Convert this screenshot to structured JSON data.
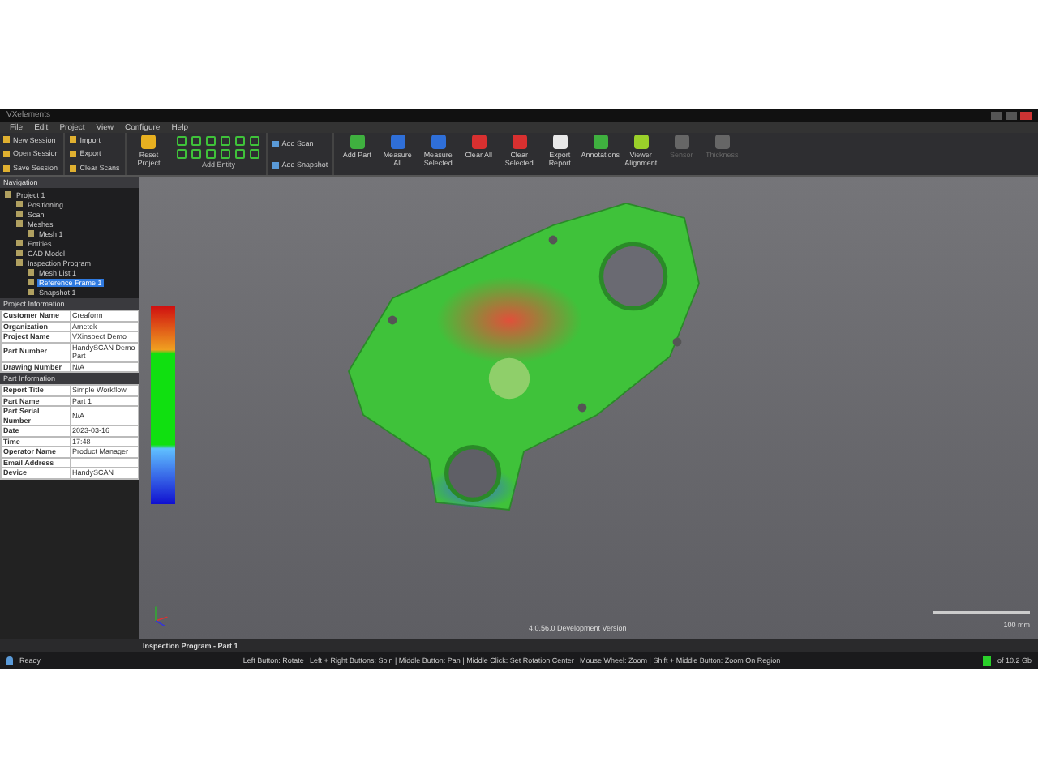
{
  "window": {
    "title": "VXelements"
  },
  "menu": [
    "File",
    "Edit",
    "Project",
    "View",
    "Configure",
    "Help"
  ],
  "ribbon": {
    "small_groups": [
      [
        "New Session",
        "Open Session",
        "Save Session"
      ],
      [
        "Import",
        "Export",
        "Clear Scans"
      ]
    ],
    "reset": "Reset Project",
    "entity_group": "Add Entity",
    "scan_group": [
      "Add Scan",
      "Add Snapshot"
    ],
    "buttons": [
      {
        "label": "Add Part",
        "disabled": false
      },
      {
        "label": "Measure All",
        "disabled": false
      },
      {
        "label": "Measure Selected",
        "disabled": false
      },
      {
        "label": "Clear All",
        "disabled": false
      },
      {
        "label": "Clear Selected",
        "disabled": false
      },
      {
        "label": "Export Report",
        "disabled": false
      },
      {
        "label": "Annotations",
        "disabled": false
      },
      {
        "label": "Viewer Alignment",
        "disabled": false
      },
      {
        "label": "Sensor",
        "disabled": true
      },
      {
        "label": "Thickness",
        "disabled": true
      }
    ]
  },
  "navigation": {
    "title": "Navigation",
    "tree": [
      {
        "label": "Project 1",
        "selected": false,
        "children": [
          {
            "label": "Positioning",
            "selected": false
          },
          {
            "label": "Scan",
            "selected": false
          },
          {
            "label": "Meshes",
            "selected": false,
            "children": [
              {
                "label": "Mesh 1",
                "selected": false
              }
            ]
          },
          {
            "label": "Entities",
            "selected": false
          },
          {
            "label": "CAD Model",
            "selected": false
          },
          {
            "label": "Inspection Program",
            "selected": false,
            "children": [
              {
                "label": "Mesh List 1",
                "selected": false
              },
              {
                "label": "Reference Frame 1",
                "selected": true
              },
              {
                "label": "Snapshot 1",
                "selected": false
              }
            ]
          }
        ]
      }
    ]
  },
  "project_info": {
    "title": "Project Information",
    "rows": [
      [
        "Customer Name",
        "Creaform"
      ],
      [
        "Organization",
        "Ametek"
      ],
      [
        "Project Name",
        "VXinspect Demo"
      ],
      [
        "Part Number",
        "HandySCAN Demo Part"
      ],
      [
        "Drawing Number",
        "N/A"
      ]
    ]
  },
  "part_info": {
    "title": "Part Information",
    "rows": [
      [
        "Report Title",
        "Simple Workflow"
      ],
      [
        "Part Name",
        "Part 1"
      ],
      [
        "Part Serial Number",
        "N/A"
      ],
      [
        "Date",
        "2023-03-16"
      ],
      [
        "Time",
        "17:48"
      ],
      [
        "Operator Name",
        "Product Manager"
      ],
      [
        "Email Address"
      ],
      [
        "Device",
        "HandySCAN"
      ]
    ]
  },
  "viewport": {
    "version": "4.0.56.0 Development Version",
    "scale": "100 mm",
    "title": "Inspection Program - Part 1"
  },
  "status_bar": {
    "state": "Ready",
    "hints": "Left Button: Rotate | Left + Right Buttons: Spin | Middle Button: Pan | Middle Click: Set Rotation Center | Mouse Wheel: Zoom | Shift + Middle Button: Zoom On Region",
    "memory": "of 10.2 Gb"
  }
}
